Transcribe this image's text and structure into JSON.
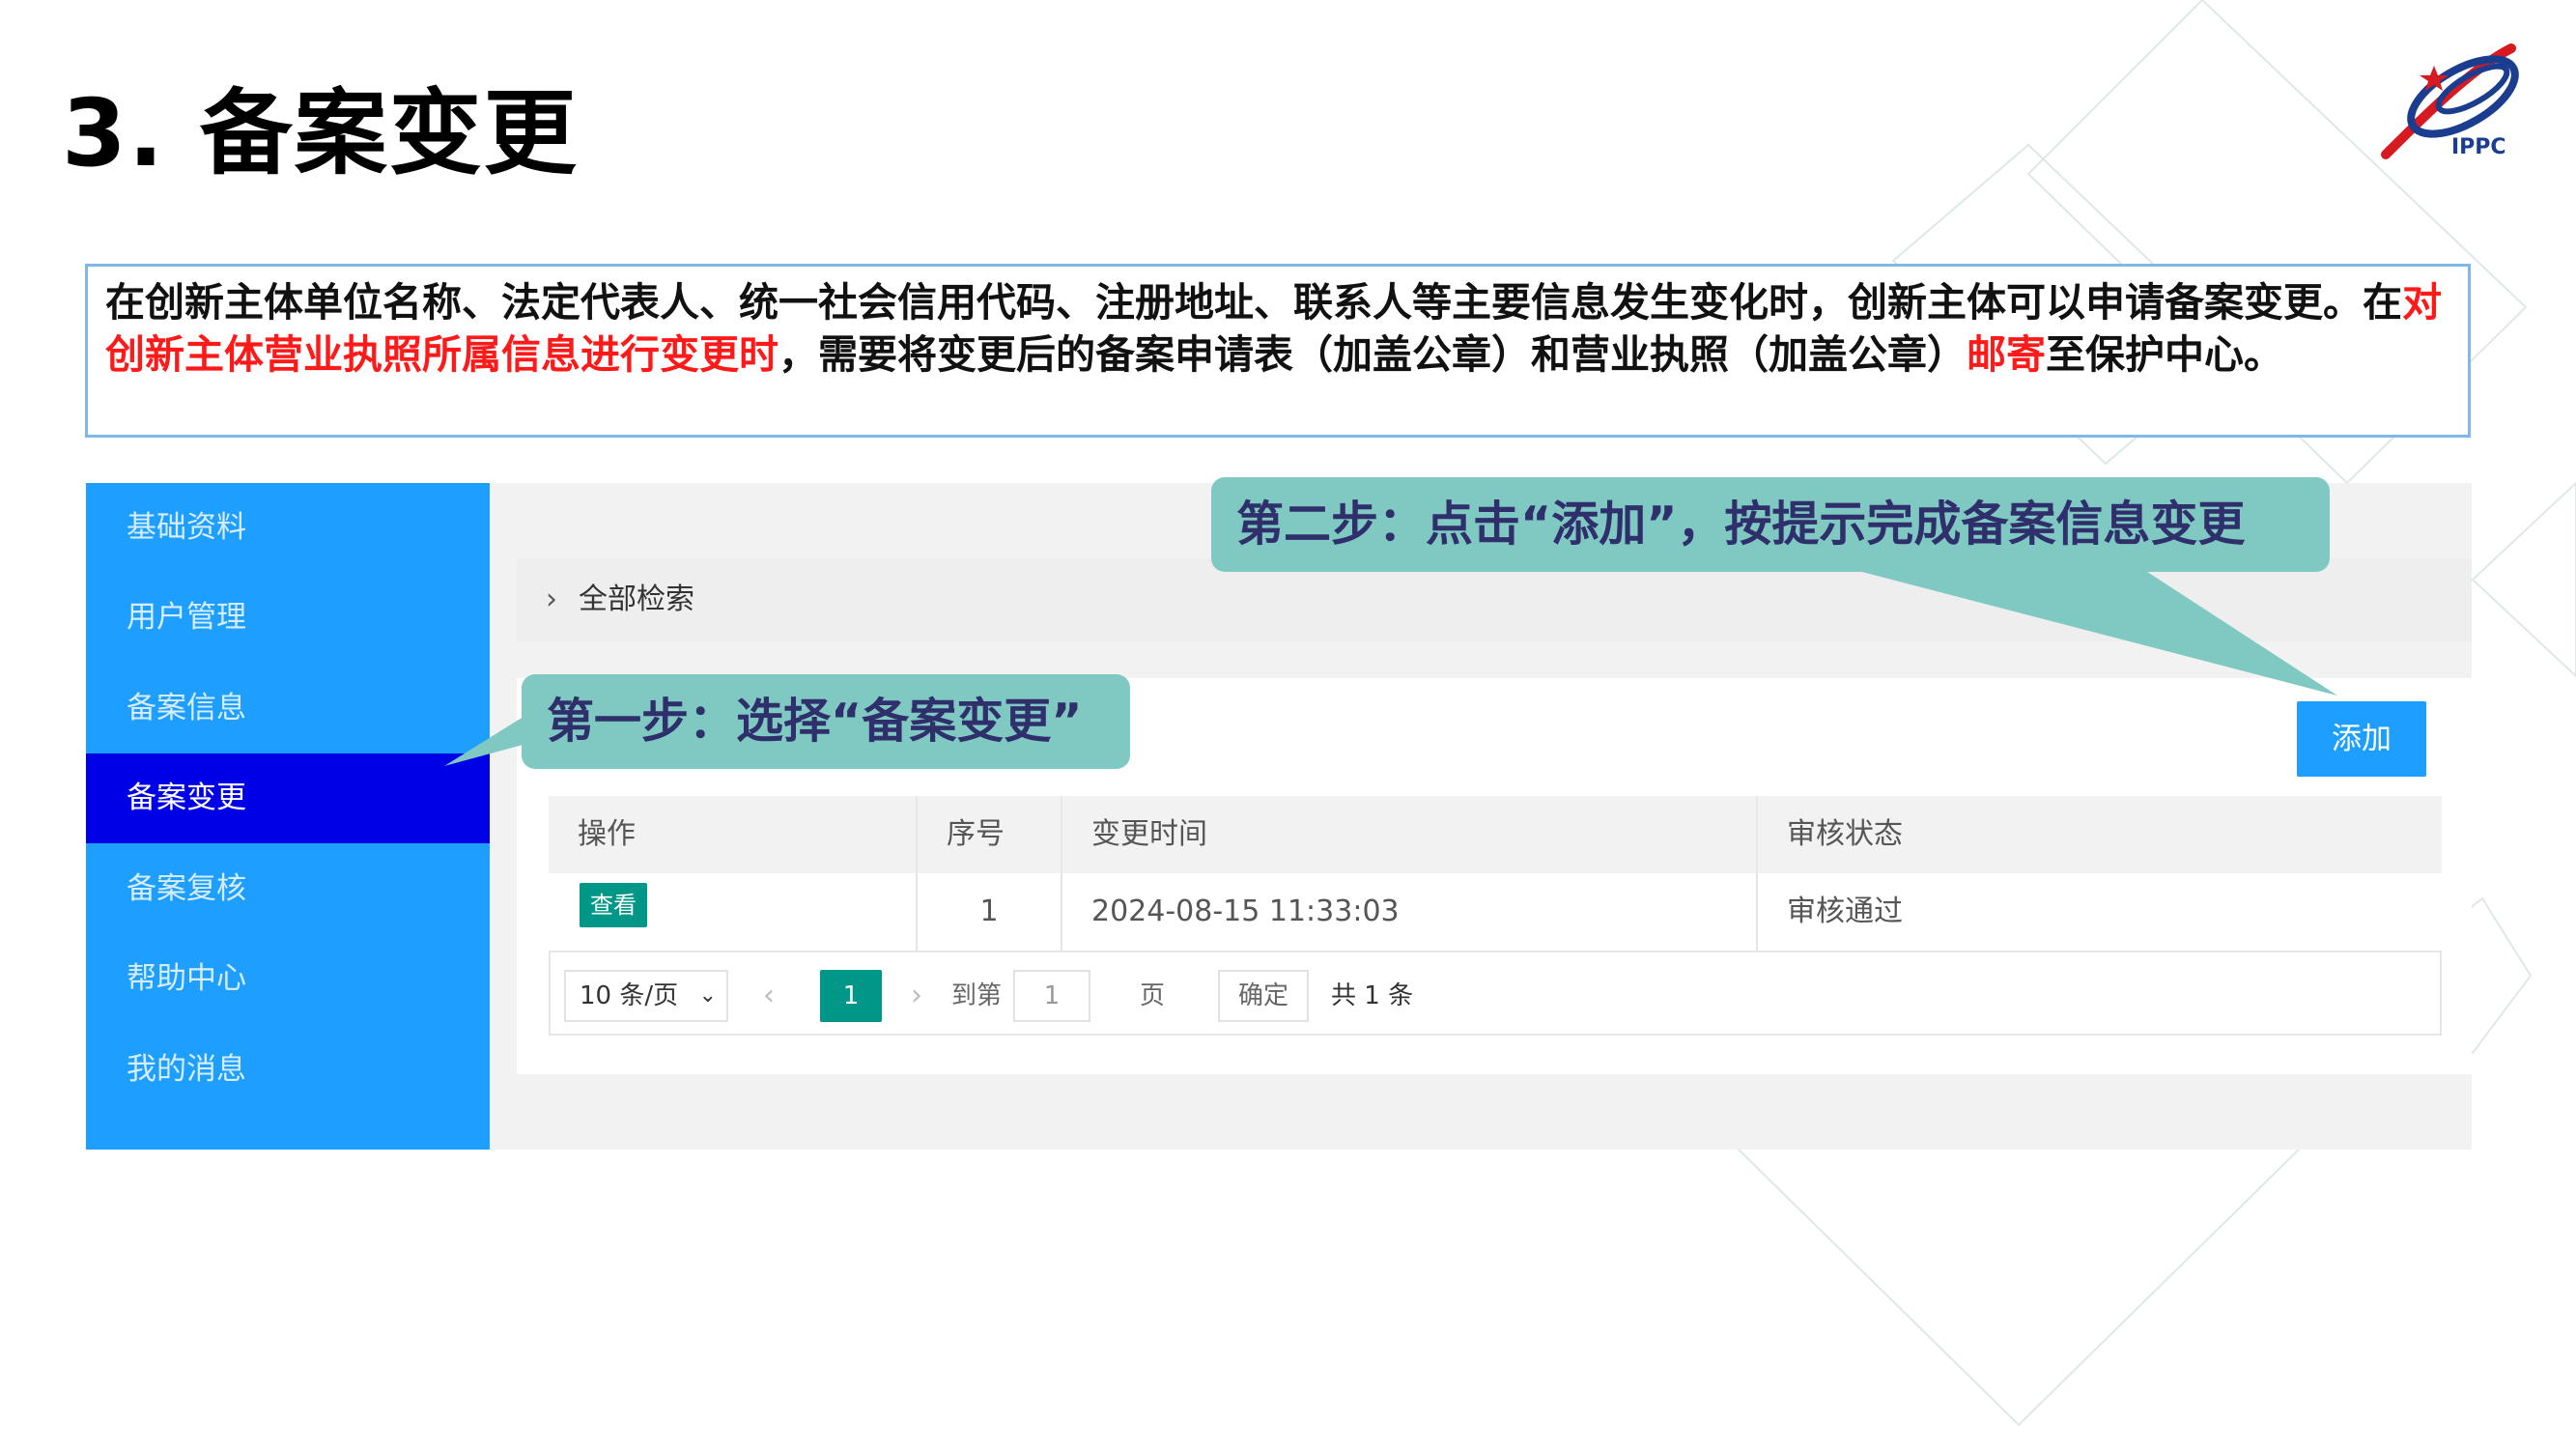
{
  "slide": {
    "title": "3. 备案变更",
    "logo_text": "IPPC",
    "intro": {
      "part1": "在创新主体单位名称、法定代表人、统一社会信用代码、注册地址、联系人等主要信息发生变化时，创新主体可以申请备案变更。在",
      "highlight1": "对创新主体营业执照所属信息进行变更时",
      "part2": "，需要将变更后的备案申请表（加盖公章）和营业执照（加盖公章）",
      "highlight2": "邮寄",
      "part3": "至保护中心。"
    },
    "callout_step1": "第一步：选择“备案变更”",
    "callout_step2": "第二步：点击“添加”，按提示完成备案信息变更"
  },
  "colors": {
    "sidebar_bg": "#1e9fff",
    "sidebar_active": "#0000e6",
    "primary_button": "#1e9fff",
    "tag_green": "#009688",
    "highlight_red": "#ff1a1a",
    "callout_bg": "#7fc9c2"
  },
  "sidebar": {
    "items": [
      {
        "label": "基础资料"
      },
      {
        "label": "用户管理"
      },
      {
        "label": "备案信息"
      },
      {
        "label": "备案变更"
      },
      {
        "label": "备案复核"
      },
      {
        "label": "帮助中心"
      },
      {
        "label": "我的消息"
      }
    ]
  },
  "search": {
    "chevron_icon": "chevron-right-icon",
    "label": "全部检索"
  },
  "toolbar": {
    "add_label": "添加"
  },
  "table": {
    "headers": [
      "操作",
      "序号",
      "变更时间",
      "审核状态"
    ],
    "rows": [
      {
        "action": "查看",
        "index": "1",
        "time": "2024-08-15 11:33:03",
        "status": "审核通过"
      }
    ]
  },
  "pager": {
    "page_size": "10 条/页",
    "current_page": "1",
    "goto_label": "到第",
    "goto_value": "1",
    "page_unit": "页",
    "confirm_label": "确定",
    "total_label": "共 1 条",
    "prev_icon": "chevron-left-icon",
    "next_icon": "chevron-right-icon"
  }
}
